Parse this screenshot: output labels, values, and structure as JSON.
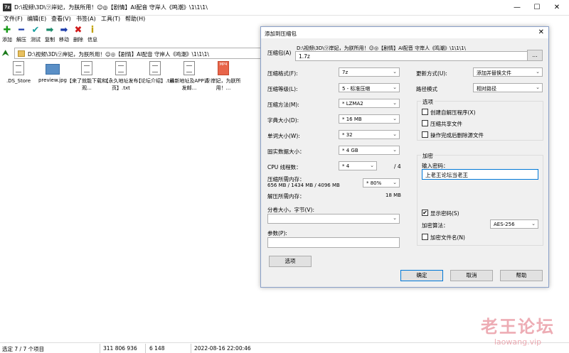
{
  "window": {
    "title": "D:\\视频\\3D\\㋡岸妃，为朕所用！☺◎【剧情】AI配音 守岸人《鸣潮》\\1\\1\\1\\",
    "minimize": "—",
    "maximize": "☐",
    "close": "✕"
  },
  "menu": [
    "文件(F)",
    "编辑(E)",
    "查看(V)",
    "书签(A)",
    "工具(T)",
    "帮助(H)"
  ],
  "toolbar": [
    {
      "label": "添加",
      "icon": "plus-icon",
      "glyph": "✚",
      "color": "#1a9a1a"
    },
    {
      "label": "解压",
      "icon": "minus-icon",
      "glyph": "━",
      "color": "#1a3aaa"
    },
    {
      "label": "测试",
      "icon": "check-icon",
      "glyph": "✔",
      "color": "#1aa0a0"
    },
    {
      "label": "复制",
      "icon": "copy-arrow-icon",
      "glyph": "➡",
      "color": "#1a8a6a"
    },
    {
      "label": "移动",
      "icon": "move-arrow-icon",
      "glyph": "➡",
      "color": "#1a3aaa"
    },
    {
      "label": "删除",
      "icon": "delete-icon",
      "glyph": "✖",
      "color": "#d01a1a"
    },
    {
      "label": "信息",
      "icon": "info-icon",
      "glyph": "i",
      "color": "#c0a000"
    }
  ],
  "path": "D:\\视频\\3D\\㋡岸妃，为朕所用！☺◎【剧情】AI配音 守岸人《鸣潮》\\1\\1\\1\\",
  "files": [
    {
      "name": ".DS_Store",
      "type": "doc"
    },
    {
      "name": "preview.jpg",
      "type": "img"
    },
    {
      "name": "【来了就能下载和观...",
      "type": "doc"
    },
    {
      "name": "【永久地址发布页】.txt",
      "type": "doc"
    },
    {
      "name": "【论坛介绍】.txt",
      "type": "doc"
    },
    {
      "name": "最新地址及APP请发邮...",
      "type": "doc"
    },
    {
      "name": "㋡岸妃，为朕所用！...",
      "type": "mp4",
      "badge": "MP4"
    }
  ],
  "status": {
    "selected": "选定 7 / 7 个项目",
    "size": "311 806 936",
    "packed": "6 148",
    "modified": "2022-08-16 22:00:46"
  },
  "dialog": {
    "title": "添加到压缩包",
    "close": "✕",
    "archive_label": "压缩包(A)",
    "archive_path": "D:\\视频\\3D\\㋡岸妃，为朕所用！☺◎【剧情】AI配音 守岸人《鸣潮》\\1\\1\\1\\",
    "archive_name": "1.7z",
    "browse": "...",
    "format_label": "压缩格式(F):",
    "format": "7z",
    "level_label": "压缩等级(L):",
    "level": "5 - 标准压缩",
    "method_label": "压缩方法(M):",
    "method": "* LZMA2",
    "dict_label": "字典大小(D):",
    "dict": "* 16 MB",
    "word_label": "单词大小(W):",
    "word": "* 32",
    "solid_label": "固实数据大小：",
    "solid": "* 4 GB",
    "cpu_label": "CPU 线程数：",
    "cpu": "* 4",
    "cpu_total": "/ 4",
    "mem_comp_label": "压缩所需内存：",
    "mem_comp_values": "656 MB / 1434 MB / 4096 MB",
    "mem_comp_pct": "* 80%",
    "mem_decomp_label": "解压所需内存：",
    "mem_decomp": "18 MB",
    "split_label": "分卷大小，字节(V):",
    "split": "",
    "params_label": "参数(P):",
    "params": "",
    "options_btn": "选项",
    "update_label": "更新方式(U):",
    "update": "添加并替换文件",
    "pathmode_label": "路径模式",
    "pathmode": "相对路径",
    "options_group": "选项",
    "opt_sfx": "创建自解压程序(X)",
    "opt_shared": "压缩共享文件",
    "opt_delete": "操作完成后删除源文件",
    "enc_group": "加密",
    "pw_label": "输入密码：",
    "password": "上老王论坛当老王",
    "show_pw": "显示密码(S)",
    "show_pw_check": "✔",
    "enc_method_label": "加密算法：",
    "enc_method": "AES-256",
    "enc_names": "加密文件名(N)",
    "ok": "确定",
    "cancel": "取消",
    "help": "帮助"
  },
  "watermark": {
    "line1": "老王论坛",
    "line2": "laowang.vip"
  }
}
